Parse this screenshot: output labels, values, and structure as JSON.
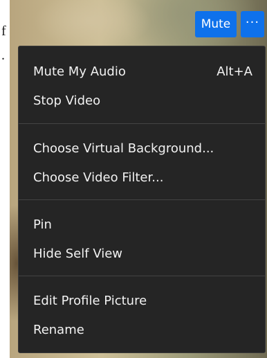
{
  "page_strip": {
    "glyphs": [
      "f",
      "."
    ]
  },
  "toolbar": {
    "mute_label": "Mute",
    "more_label": "···"
  },
  "menu": {
    "items": [
      {
        "label": "Mute My Audio",
        "shortcut": "Alt+A"
      },
      {
        "label": "Stop Video"
      },
      {
        "label": "Choose Virtual Background..."
      },
      {
        "label": "Choose Video Filter..."
      },
      {
        "label": "Pin"
      },
      {
        "label": "Hide Self View"
      },
      {
        "label": "Edit Profile Picture"
      },
      {
        "label": "Rename"
      }
    ]
  },
  "colors": {
    "button_blue": "#0e71eb",
    "menu_background": "#252525",
    "menu_text": "#f2f2f2",
    "divider": "#444444"
  }
}
